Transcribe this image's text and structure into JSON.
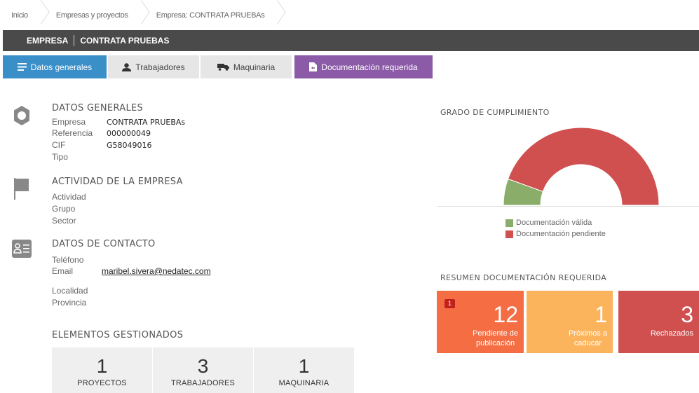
{
  "breadcrumb": [
    "Inicio",
    "Empresas y proyectos",
    "Empresa: CONTRATA PRUEBAs"
  ],
  "company_bar": {
    "label": "EMPRESA",
    "name": "CONTRATA PRUEBAS"
  },
  "tabs": [
    {
      "label": "Datos generales",
      "icon": "list-icon"
    },
    {
      "label": "Trabajadores",
      "icon": "user-icon"
    },
    {
      "label": "Maquinaria",
      "icon": "truck-icon"
    },
    {
      "label": "Documentación requerida",
      "icon": "document-icon"
    }
  ],
  "datos_generales": {
    "title": "DATOS GENERALES",
    "empresa_label": "Empresa",
    "empresa_value": "CONTRATA PRUEBAs",
    "referencia_label": "Referencia",
    "referencia_value": "000000049",
    "cif_label": "CIF",
    "cif_value": "G58049016",
    "tipo_label": "Tipo"
  },
  "actividad": {
    "title": "ACTIVIDAD DE LA EMPRESA",
    "actividad_label": "Actividad",
    "grupo_label": "Grupo",
    "sector_label": "Sector"
  },
  "contacto": {
    "title": "DATOS DE CONTACTO",
    "telefono_label": "Teléfono",
    "email_label": "Email",
    "email_value": "maribel.sivera@nedatec.com",
    "localidad_label": "Localidad",
    "provincia_label": "Provincia"
  },
  "elementos": {
    "title": "ELEMENTOS GESTIONADOS",
    "items": [
      {
        "value": "1",
        "label": "PROYECTOS"
      },
      {
        "value": "3",
        "label": "TRABAJADORES"
      },
      {
        "value": "1",
        "label": "MAQUINARIA"
      }
    ]
  },
  "grado": {
    "title": "GRADO DE CUMPLIMIENTO",
    "legend_valid": "Documentación válida",
    "legend_pending": "Documentación pendiente"
  },
  "chart_data": {
    "type": "pie",
    "slices": [
      {
        "name": "Documentación válida",
        "value": 11,
        "color": "#8aad6a"
      },
      {
        "name": "Documentación pendiente",
        "value": 89,
        "color": "#d05050"
      }
    ]
  },
  "resumen": {
    "title": "RESUMEN DOCUMENTACIÓN REQUERIDA",
    "cards": [
      {
        "value": "12",
        "label_line1": "Pendiente de",
        "label_line2": "publicación",
        "badge": "1",
        "color": "#f46d43"
      },
      {
        "value": "1",
        "label_line1": "Próximos a",
        "label_line2": "caducar",
        "color": "#fcb45c"
      },
      {
        "value": "3",
        "label_line1": "Rechazados",
        "color": "#d0504f"
      }
    ]
  },
  "colors": {
    "tab_active": "#3a8fc9",
    "tab_doc": "#8b5ba8",
    "company_bar": "#4a4a4a"
  }
}
